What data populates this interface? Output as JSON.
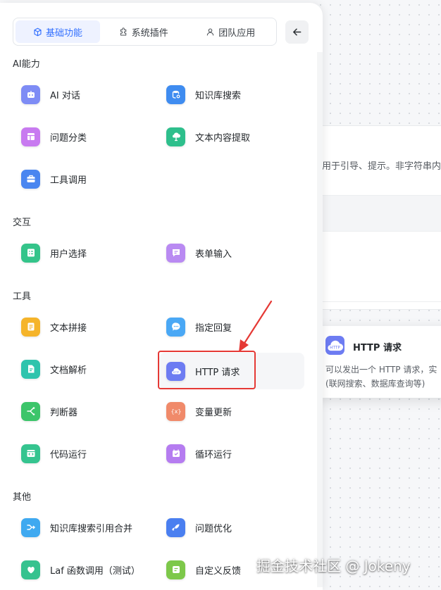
{
  "background": {
    "node_hint": "用于引导、提示。非字符串内容"
  },
  "tabs": [
    {
      "label": "基础功能",
      "active": true
    },
    {
      "label": "系统插件",
      "active": false
    },
    {
      "label": "团队应用",
      "active": false
    }
  ],
  "sections": [
    {
      "title": "AI能力",
      "items": [
        {
          "label": "AI 对话",
          "icon": "robot-icon",
          "color": "#7e8cf5"
        },
        {
          "label": "知识库搜索",
          "icon": "database-icon",
          "color": "#3f8cf0"
        },
        {
          "label": "问题分类",
          "icon": "layout-icon",
          "color": "#c87af0"
        },
        {
          "label": "文本内容提取",
          "icon": "cloud-tree-icon",
          "color": "#2ebf8c"
        },
        {
          "label": "工具调用",
          "icon": "toolbox-icon",
          "color": "#4a86f0"
        }
      ]
    },
    {
      "title": "交互",
      "items": [
        {
          "label": "用户选择",
          "icon": "checklist-icon",
          "color": "#34c48a"
        },
        {
          "label": "表单输入",
          "icon": "form-icon",
          "color": "#b98af2"
        }
      ]
    },
    {
      "title": "工具",
      "items": [
        {
          "label": "文本拼接",
          "icon": "text-icon",
          "color": "#f5b42a"
        },
        {
          "label": "指定回复",
          "icon": "chat-bubble-icon",
          "color": "#4aa8f5"
        },
        {
          "label": "文档解析",
          "icon": "document-icon",
          "color": "#2fc4ad"
        },
        {
          "label": "HTTP 请求",
          "icon": "http-cloud-icon",
          "color": "#6d7cf2"
        },
        {
          "label": "判断器",
          "icon": "branch-icon",
          "color": "#3cc56a"
        },
        {
          "label": "变量更新",
          "icon": "variable-icon",
          "color": "#f08a6a"
        },
        {
          "label": "代码运行",
          "icon": "code-icon",
          "color": "#35c48f"
        },
        {
          "label": "循环运行",
          "icon": "loop-icon",
          "color": "#b57cf0"
        }
      ]
    },
    {
      "title": "其他",
      "items": [
        {
          "label": "知识库搜索引用合并",
          "icon": "merge-icon",
          "color": "#3fa9f0"
        },
        {
          "label": "问题优化",
          "icon": "rocket-icon",
          "color": "#4a7ff0"
        },
        {
          "label": "Laf 函数调用（测试）",
          "icon": "laf-icon",
          "color": "#36c28f"
        },
        {
          "label": "自定义反馈",
          "icon": "feedback-icon",
          "color": "#7dc84a"
        }
      ]
    }
  ],
  "tooltip": {
    "title": "HTTP 请求",
    "desc_line1": "可以发出一个 HTTP 请求，实",
    "desc_line2": "(联网搜索、数据库查询等)"
  },
  "watermark": "掘金技术社区 @ Jokeny"
}
